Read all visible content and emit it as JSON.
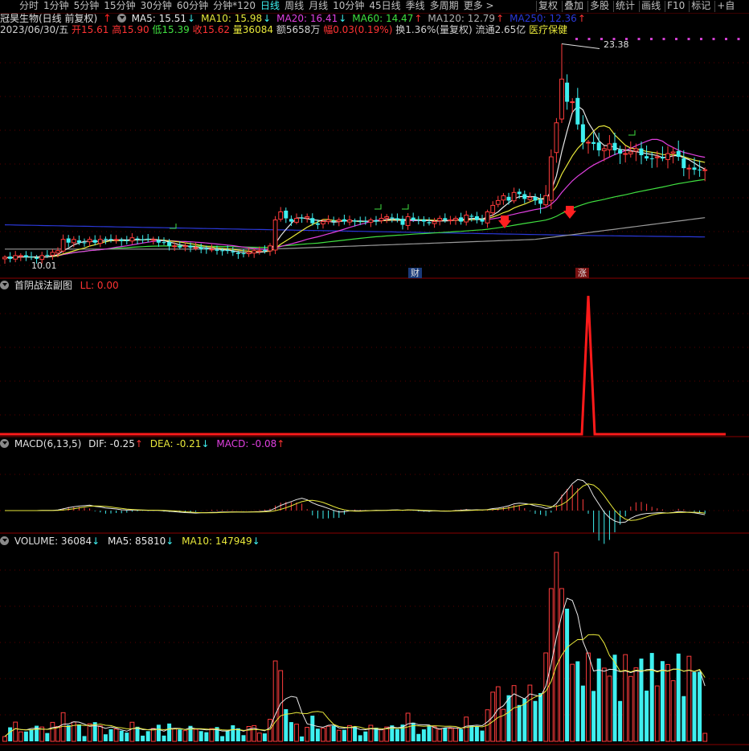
{
  "toolbar": {
    "periods": [
      "分时",
      "1分钟",
      "5分钟",
      "15分钟",
      "30分钟",
      "60分钟",
      "分钟*120",
      "日线",
      "周线",
      "月线",
      "10分钟",
      "45日线",
      "季线",
      "多周期",
      "更多 >"
    ],
    "active_period": "日线",
    "tools": [
      "复权",
      "叠加",
      "多股",
      "统计",
      "画线",
      "F10",
      "标记",
      "+自"
    ]
  },
  "stock": {
    "name": "冠昊生物(日线 前复权)",
    "ma": [
      {
        "label": "MA5: 15.51",
        "arrow": "↓",
        "color": "#e8e8e8"
      },
      {
        "label": "MA10: 15.98",
        "arrow": "↓",
        "color": "#e8e83a"
      },
      {
        "label": "MA20: 16.41",
        "arrow": "↓",
        "color": "#e040e0"
      },
      {
        "label": "MA60: 14.47",
        "arrow": "↑",
        "color": "#40e040"
      },
      {
        "label": "MA120: 12.79",
        "arrow": "↑",
        "color": "#b0b0b0"
      },
      {
        "label": "MA250: 12.36",
        "arrow": "↑",
        "color": "#2a38d8"
      }
    ],
    "date": "2023/06/30/五",
    "open": "开15.61",
    "high": "高15.90",
    "low": "低15.39",
    "close": "收15.62",
    "volume": "量36084",
    "amount": "额5658万",
    "change": "幅0.03(0.19%)",
    "turnover": "换1.36%(量复权)",
    "float_cap": "流通2.65亿",
    "industry": "医疗保健",
    "max_price_label": "23.38",
    "min_price_label": "10.01",
    "marker_cai": "财",
    "marker_zhang": "涨"
  },
  "sub1": {
    "title": "首阴战法副图",
    "ll": "LL: 0.00"
  },
  "macd": {
    "title": "MACD(6,13,5)",
    "dif": "DIF: -0.25",
    "dif_arrow": "↑",
    "dea": "DEA: -0.21",
    "dea_arrow": "↓",
    "macd": "MACD: -0.08",
    "macd_arrow": "↑"
  },
  "vol": {
    "title": "VOLUME: 36084",
    "title_arrow": "↓",
    "ma5": "MA5: 85810",
    "ma5_arrow": "↓",
    "ma10": "MA10: 147949",
    "ma10_arrow": "↓"
  },
  "chart_data": {
    "type": "candlestick",
    "close": [
      10.2,
      10.1,
      10.3,
      10.3,
      10.2,
      10.2,
      10.1,
      10.3,
      10.3,
      10.5,
      10.6,
      11.3,
      11.1,
      11.3,
      11.1,
      11.1,
      11.3,
      11.1,
      11.3,
      11.3,
      11.3,
      11.3,
      11.2,
      11.2,
      11.4,
      11.3,
      11.3,
      11.3,
      11.3,
      11.1,
      11.1,
      10.9,
      10.9,
      10.8,
      10.9,
      10.8,
      10.8,
      10.7,
      10.7,
      10.7,
      10.6,
      10.6,
      10.6,
      10.5,
      10.4,
      10.4,
      10.5,
      10.6,
      10.6,
      10.6,
      10.9,
      12.5,
      13.0,
      12.6,
      12.4,
      12.6,
      12.6,
      12.7,
      12.3,
      12.2,
      12.4,
      12.5,
      12.4,
      12.5,
      12.4,
      12.5,
      12.4,
      12.4,
      12.4,
      12.5,
      12.4,
      12.6,
      12.7,
      12.6,
      12.5,
      12.2,
      12.7,
      12.5,
      12.5,
      12.4,
      12.3,
      12.4,
      12.6,
      12.5,
      12.5,
      12.6,
      12.4,
      12.8,
      12.7,
      12.5,
      12.4,
      13.0,
      13.4,
      13.7,
      14.0,
      13.7,
      14.2,
      14.1,
      13.8,
      13.9,
      13.7,
      13.5,
      14.0,
      16.4,
      18.5,
      21.2,
      19.8,
      19.8,
      18.4,
      17.3,
      17.3,
      17.2,
      16.8,
      16.9,
      17.2,
      16.8,
      16.6,
      16.6,
      16.7,
      16.9,
      16.5,
      16.3,
      16.3,
      16.4,
      16.3,
      16.6,
      16.7,
      16.4,
      15.7,
      15.7,
      15.6,
      15.6,
      15.6
    ],
    "ma": [
      "MA5",
      "MA10",
      "MA20",
      "MA60",
      "MA120",
      "MA250"
    ],
    "volume_label": "VOLUME",
    "price_range": [
      10.01,
      23.38
    ]
  }
}
